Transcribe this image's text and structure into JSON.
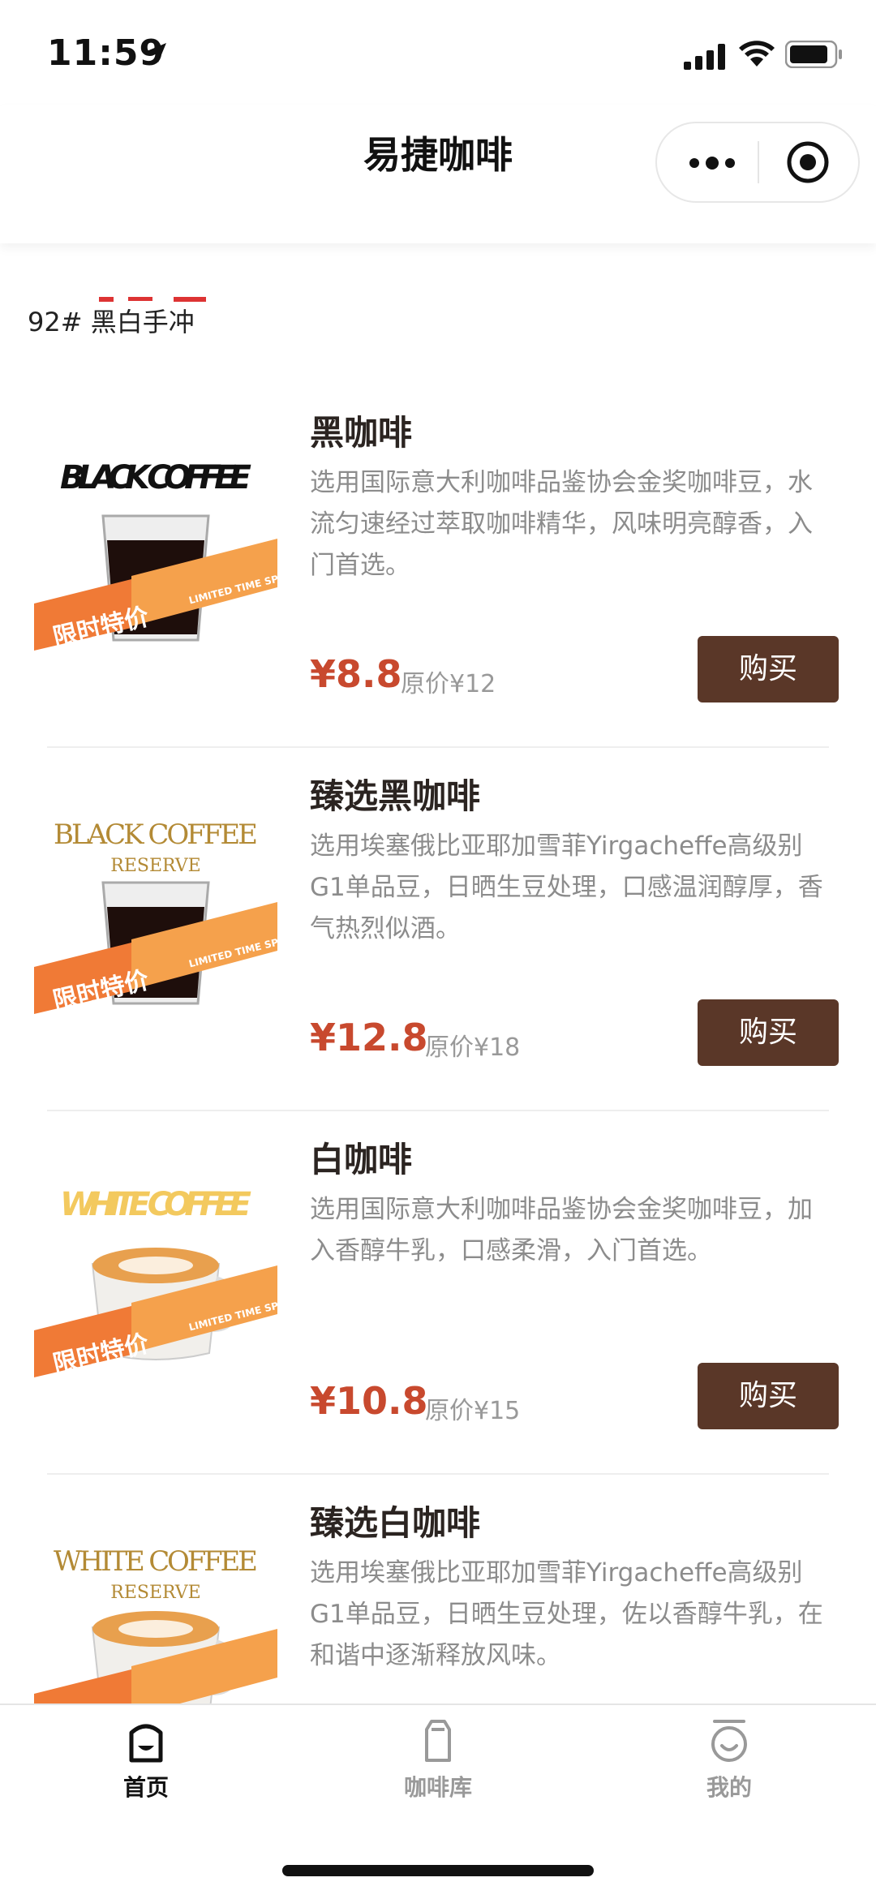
{
  "status": {
    "time": "11:59"
  },
  "nav": {
    "title": "易捷咖啡"
  },
  "section": {
    "title": "92# 黑白手冲"
  },
  "colors": {
    "accent_price": "#c8492e",
    "buy_button": "#5a3728",
    "tab_active": "#111111",
    "tab_inactive": "#999999"
  },
  "products": [
    {
      "name": "黑咖啡",
      "description": "选用国际意大利咖啡品鉴协会金奖咖啡豆，水流匀速经过萃取咖啡精华，风味明亮醇香，入门首选。",
      "price": "¥8.8",
      "original_price": "原价¥12",
      "buy_label": "购买",
      "image": {
        "logo": "BLACK COFFEE",
        "badge": "限时特价",
        "badge_sub": "LIMITED TIME SPECIAL OFFER"
      }
    },
    {
      "name": "臻选黑咖啡",
      "description": "选用埃塞俄比亚耶加雪菲Yirgacheffe高级别G1单品豆，日晒生豆处理，口感温润醇厚，香气热烈似酒。",
      "price": "¥12.8",
      "original_price": "原价¥18",
      "buy_label": "购买",
      "image": {
        "logo": "BLACK COFFEE",
        "logo_sub": "RESERVE",
        "badge": "限时特价",
        "badge_sub": "LIMITED TIME SPECIAL OFFER"
      }
    },
    {
      "name": "白咖啡",
      "description": "选用国际意大利咖啡品鉴协会金奖咖啡豆，加入香醇牛乳，口感柔滑，入门首选。",
      "price": "¥10.8",
      "original_price": "原价¥15",
      "buy_label": "购买",
      "image": {
        "logo": "WHITE COFFEE",
        "badge": "限时特价",
        "badge_sub": "LIMITED TIME SPECIAL OFFER"
      }
    },
    {
      "name": "臻选白咖啡",
      "description": "选用埃塞俄比亚耶加雪菲Yirgacheffe高级别G1单品豆，日晒生豆处理，佐以香醇牛乳，在和谐中逐渐释放风味。",
      "image": {
        "logo": "WHITE COFFEE",
        "logo_sub": "RESERVE"
      }
    }
  ],
  "tabs": [
    {
      "label": "首页",
      "icon": "home-icon",
      "active": true
    },
    {
      "label": "咖啡库",
      "icon": "coffee-library-icon",
      "active": false
    },
    {
      "label": "我的",
      "icon": "profile-icon",
      "active": false
    }
  ]
}
